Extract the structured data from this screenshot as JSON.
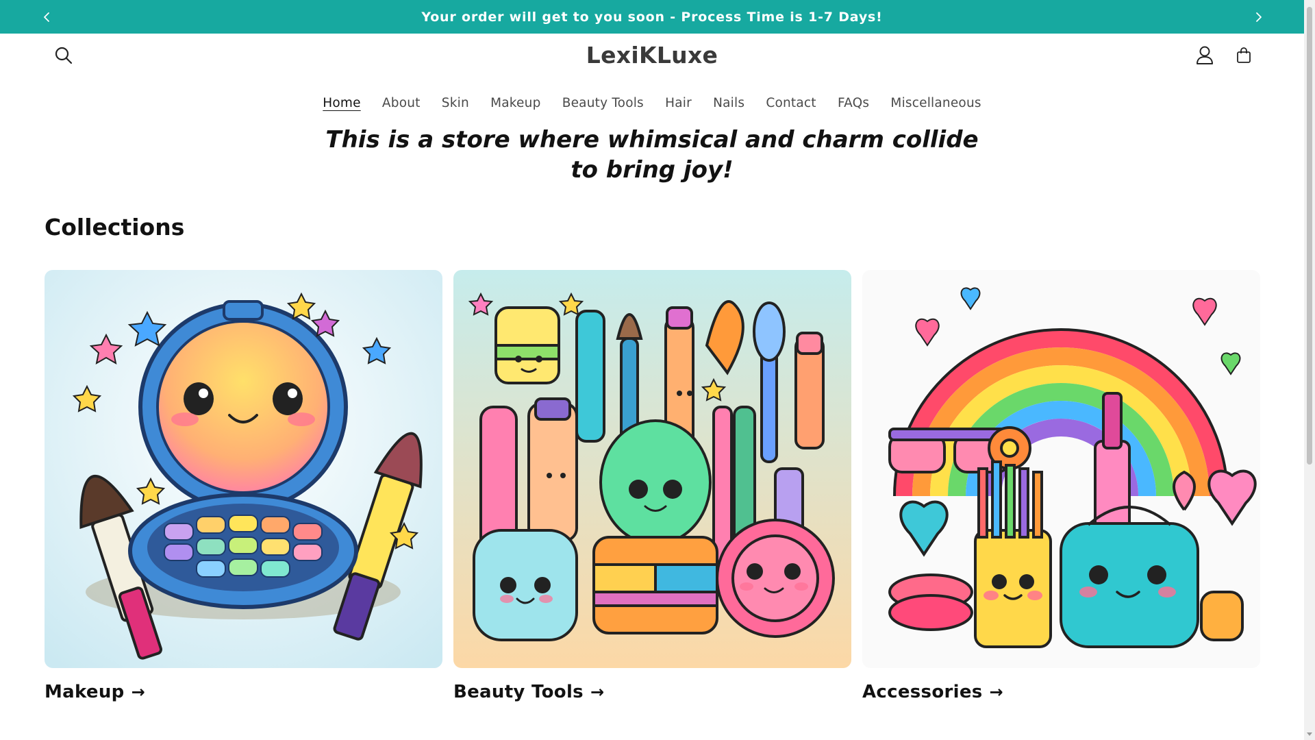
{
  "announcement": {
    "text": "Your order will get to you soon - Process Time is 1-7 Days!",
    "prev_icon": "chevron-left-icon",
    "next_icon": "chevron-right-icon",
    "background": "#17a9a0"
  },
  "header": {
    "logo": "LexiKLuxe",
    "search_icon": "search-icon",
    "account_icon": "user-icon",
    "cart_icon": "shopping-bag-icon"
  },
  "nav": {
    "items": [
      {
        "label": "Home",
        "active": true
      },
      {
        "label": "About"
      },
      {
        "label": "Skin"
      },
      {
        "label": "Makeup"
      },
      {
        "label": "Beauty Tools"
      },
      {
        "label": "Hair"
      },
      {
        "label": "Nails"
      },
      {
        "label": "Contact"
      },
      {
        "label": "FAQs"
      },
      {
        "label": "Miscellaneous"
      }
    ]
  },
  "tagline": "This is a store where whimsical and charm collide to bring joy!",
  "collections": {
    "title": "Collections",
    "items": [
      {
        "label": "Makeup",
        "arrow": "→"
      },
      {
        "label": "Beauty Tools",
        "arrow": "→"
      },
      {
        "label": "Accessories",
        "arrow": "→"
      }
    ]
  }
}
